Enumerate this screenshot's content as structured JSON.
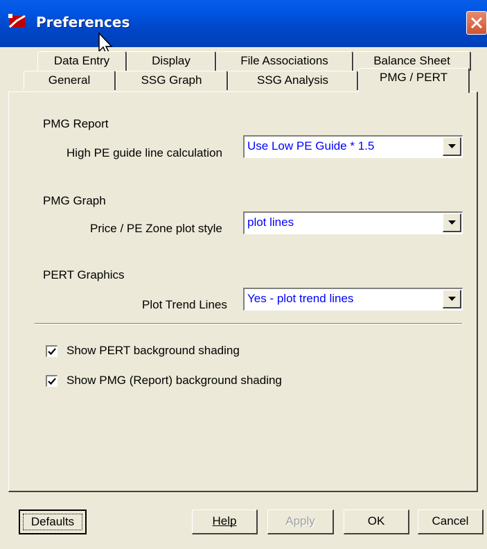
{
  "window": {
    "title": "Preferences",
    "app_icon": "app-logo-icon",
    "close_icon": "close-icon"
  },
  "tabs": {
    "row1": [
      "Data Entry",
      "Display",
      "File Associations",
      "Balance Sheet"
    ],
    "row2": [
      "General",
      "SSG Graph",
      "SSG Analysis",
      "PMG / PERT"
    ],
    "active": "PMG / PERT"
  },
  "sections": {
    "pmg_report": {
      "heading": "PMG Report",
      "label": "High PE guide line calculation",
      "value": "Use Low PE Guide * 1.5"
    },
    "pmg_graph": {
      "heading": "PMG Graph",
      "label": "Price / PE Zone plot style",
      "value": "plot lines"
    },
    "pert_graphics": {
      "heading": "PERT Graphics",
      "label": "Plot Trend Lines",
      "value": "Yes - plot trend lines"
    }
  },
  "checkboxes": [
    {
      "label": "Show PERT background shading",
      "checked": true
    },
    {
      "label": "Show PMG (Report) background shading",
      "checked": true
    }
  ],
  "buttons": {
    "defaults": "Defaults",
    "help": "Help",
    "apply": "Apply",
    "ok": "OK",
    "cancel": "Cancel"
  },
  "colors": {
    "titlebar": "#0054e3",
    "dialog": "#ece9d8",
    "dropdown_text": "#0000ff",
    "close_button": "#d2542f"
  }
}
